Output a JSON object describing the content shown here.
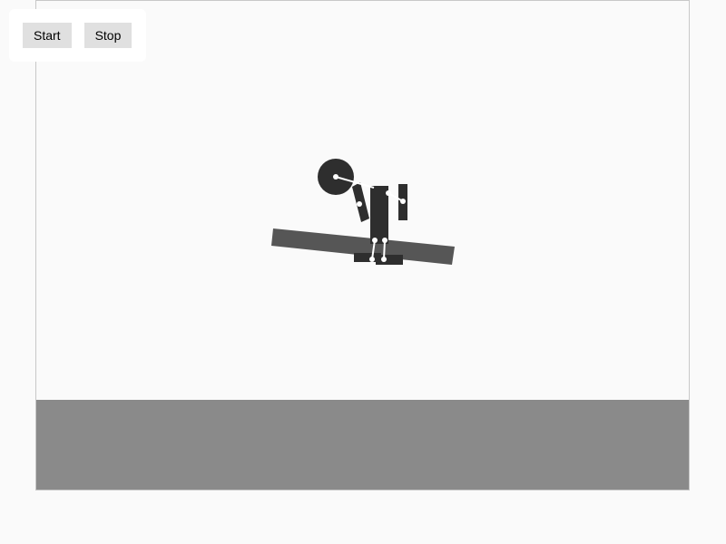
{
  "controls": {
    "start_label": "Start",
    "stop_label": "Stop"
  },
  "colors": {
    "background": "#fafafa",
    "ground": "#8a8a8a",
    "body_dark": "#2e2e2e",
    "plank": "#565656",
    "joint": "#ffffff",
    "button_bg": "#e0e0e0"
  }
}
